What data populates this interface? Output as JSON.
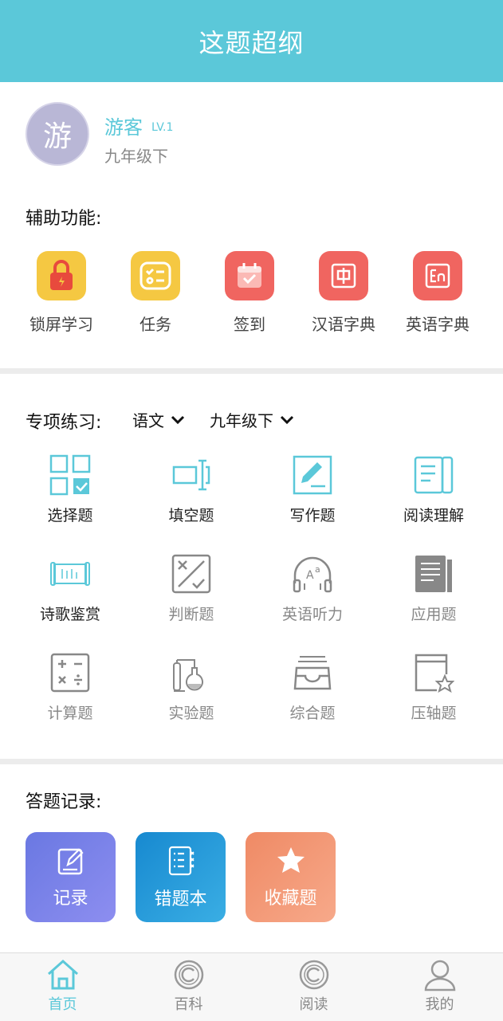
{
  "header": {
    "title": "这题超纲"
  },
  "profile": {
    "avatar_text": "游",
    "username": "游客",
    "level": "LV.1",
    "grade": "九年级下"
  },
  "aux": {
    "title": "辅助功能:",
    "items": [
      {
        "label": "锁屏学习",
        "icon": "lock-icon",
        "color": "#f5c842"
      },
      {
        "label": "任务",
        "icon": "task-icon",
        "color": "#f5c842"
      },
      {
        "label": "签到",
        "icon": "calendar-icon",
        "color": "#f06560"
      },
      {
        "label": "汉语字典",
        "icon": "chinese-dictionary-icon",
        "color": "#f06560"
      },
      {
        "label": "英语字典",
        "icon": "english-dictionary-icon",
        "color": "#f06560"
      }
    ]
  },
  "practice": {
    "title": "专项练习:",
    "subject": "语文",
    "grade": "九年级下",
    "items": [
      {
        "label": "选择题",
        "icon": "choice-icon",
        "active": true
      },
      {
        "label": "填空题",
        "icon": "fill-blank-icon",
        "active": true
      },
      {
        "label": "写作题",
        "icon": "writing-icon",
        "active": true
      },
      {
        "label": "阅读理解",
        "icon": "reading-icon",
        "active": true
      },
      {
        "label": "诗歌鉴赏",
        "icon": "poetry-scroll-icon",
        "active": true
      },
      {
        "label": "判断题",
        "icon": "judge-icon",
        "active": false
      },
      {
        "label": "英语听力",
        "icon": "headphones-icon",
        "active": false
      },
      {
        "label": "应用题",
        "icon": "application-icon",
        "active": false
      },
      {
        "label": "计算题",
        "icon": "calculator-icon",
        "active": false
      },
      {
        "label": "实验题",
        "icon": "flask-icon",
        "active": false
      },
      {
        "label": "综合题",
        "icon": "inbox-icon",
        "active": false
      },
      {
        "label": "压轴题",
        "icon": "star-card-icon",
        "active": false
      }
    ]
  },
  "records": {
    "title": "答题记录:",
    "items": [
      {
        "label": "记录",
        "icon": "edit-icon",
        "color": "#7b7ce6"
      },
      {
        "label": "错题本",
        "icon": "list-icon",
        "color": "#1a9bd8"
      },
      {
        "label": "收藏题",
        "icon": "star-icon",
        "color": "#f0916a"
      }
    ]
  },
  "tabbar": {
    "items": [
      {
        "label": "首页",
        "icon": "home-icon",
        "active": true
      },
      {
        "label": "百科",
        "icon": "copyright-icon",
        "active": false
      },
      {
        "label": "阅读",
        "icon": "copyright-icon",
        "active": false
      },
      {
        "label": "我的",
        "icon": "user-icon",
        "active": false
      }
    ]
  },
  "colors": {
    "accent": "#5bc8d9",
    "inactive": "#888888",
    "divider": "#ececec"
  }
}
